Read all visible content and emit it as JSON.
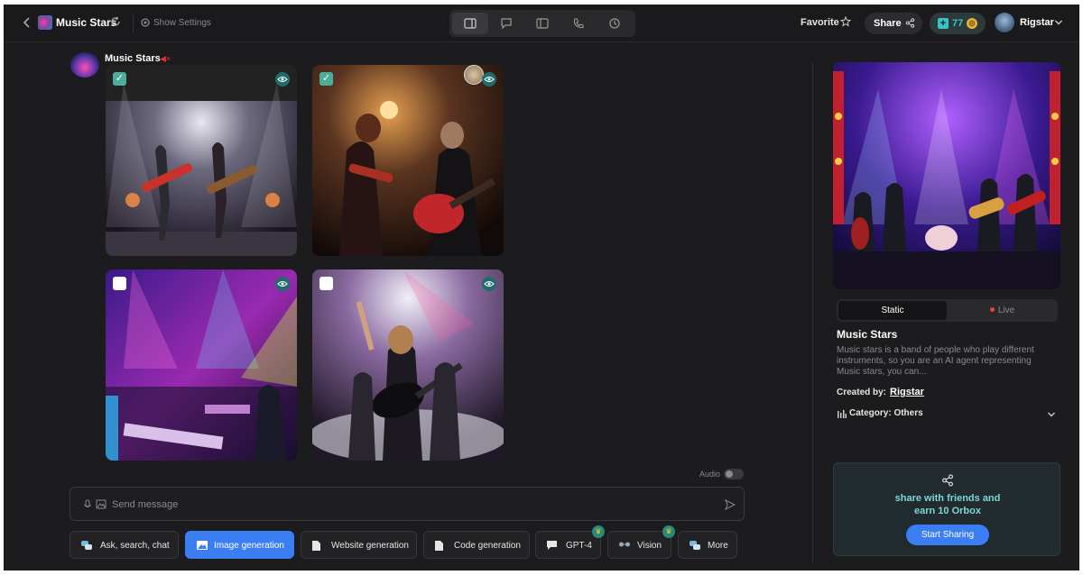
{
  "topbar": {
    "title": "Music Stars",
    "settings_label": "Show Settings",
    "favorite_label": "Favorite",
    "share_label": "Share",
    "orbox_count": "77",
    "user_name": "Rigstar"
  },
  "chat": {
    "bot_name": "Music Stars",
    "images": [
      {
        "checked": true,
        "desc": "rock duo on stage"
      },
      {
        "checked": true,
        "desc": "violin and guitar duet"
      },
      {
        "checked": false,
        "desc": "neon stage band"
      },
      {
        "checked": false,
        "desc": "guitarist in smoke"
      }
    ],
    "audio_label": "Audio",
    "composer_placeholder": "Send message"
  },
  "tools": [
    {
      "label": "Ask, search, chat",
      "icon": "chat-icon",
      "active": false
    },
    {
      "label": "Image generation",
      "icon": "image-icon",
      "active": true
    },
    {
      "label": "Website generation",
      "icon": "document-icon",
      "active": false
    },
    {
      "label": "Code generation",
      "icon": "document-icon",
      "active": false
    },
    {
      "label": "GPT-4",
      "icon": "chat-bubble-icon",
      "active": false,
      "premium": true
    },
    {
      "label": "Vision",
      "icon": "glasses-icon",
      "active": false,
      "premium": true
    },
    {
      "label": "More",
      "icon": "grid-icon",
      "active": false
    }
  ],
  "panel": {
    "seg_static": "Static",
    "seg_live": "Live",
    "title": "Music Stars",
    "description": "Music stars is a band of people who play different instruments, so you are an AI agent representing Music stars, you can...",
    "created_by_label": "Created by:",
    "creator": "Rigstar",
    "category": "Category: Others",
    "promo_text_1": "share with friends and",
    "promo_text_2": "earn 10 Orbox",
    "promo_button": "Start Sharing"
  },
  "colors": {
    "accent": "#3b7df2",
    "teal": "#39c4c4",
    "background": "#1c1c1e"
  }
}
